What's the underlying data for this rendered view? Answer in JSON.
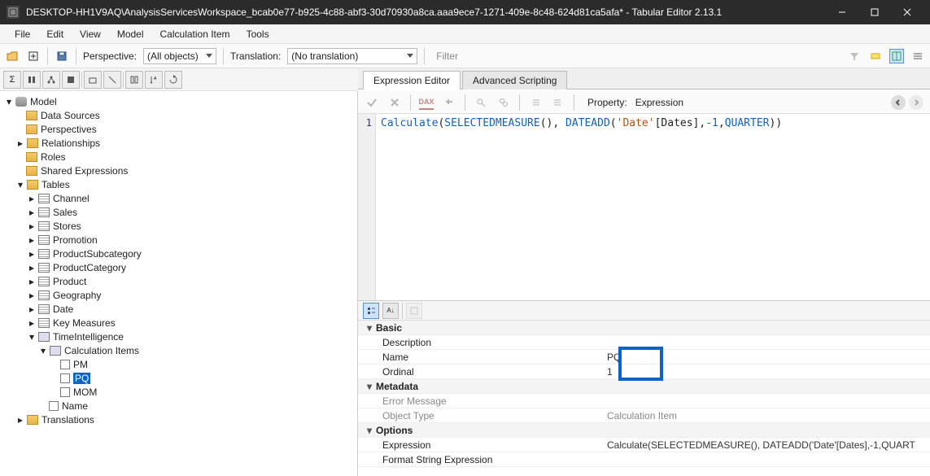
{
  "window": {
    "title": "DESKTOP-HH1V9AQ\\AnalysisServicesWorkspace_bcab0e77-b925-4c88-abf3-30d70930a8ca.aaa9ece7-1271-409e-8c48-624d81ca5afa* - Tabular Editor 2.13.1"
  },
  "menu": {
    "file": "File",
    "edit": "Edit",
    "view": "View",
    "model": "Model",
    "calc": "Calculation Item",
    "tools": "Tools"
  },
  "toolbar1": {
    "perspective_label": "Perspective:",
    "perspective_value": "(All objects)",
    "translation_label": "Translation:",
    "translation_value": "(No translation)",
    "filter_placeholder": "Filter"
  },
  "tree": {
    "model": "Model",
    "data_sources": "Data Sources",
    "perspectives": "Perspectives",
    "relationships": "Relationships",
    "roles": "Roles",
    "shared_expr": "Shared Expressions",
    "tables": "Tables",
    "t_channel": "Channel",
    "t_sales": "Sales",
    "t_stores": "Stores",
    "t_promotion": "Promotion",
    "t_psub": "ProductSubcategory",
    "t_pcat": "ProductCategory",
    "t_product": "Product",
    "t_geo": "Geography",
    "t_date": "Date",
    "t_key": "Key Measures",
    "t_ti": "TimeIntelligence",
    "calc_items": "Calculation Items",
    "ci_pm": "PM",
    "ci_pq": "PQ",
    "ci_mom": "MOM",
    "col_name": "Name",
    "translations": "Translations"
  },
  "tabs": {
    "expr": "Expression Editor",
    "adv": "Advanced Scripting"
  },
  "exprbar": {
    "property_label": "Property:",
    "property_value": "Expression"
  },
  "code": {
    "line1_a": "Calculate",
    "line1_b": "SELECTEDMEASURE",
    "line1_c": "DATEADD",
    "line1_d": "'Date'",
    "line1_e": "[Dates]",
    "line1_f": "-1",
    "line1_g": "QUARTER"
  },
  "propgrid": {
    "cat_basic": "Basic",
    "p_desc": "Description",
    "p_name": "Name",
    "p_name_v": "PQ",
    "p_ordinal": "Ordinal",
    "p_ordinal_v": "1",
    "cat_meta": "Metadata",
    "p_err": "Error Message",
    "p_objtype": "Object Type",
    "p_objtype_v": "Calculation Item",
    "cat_opt": "Options",
    "p_expr": "Expression",
    "p_expr_v": "Calculate(SELECTEDMEASURE(), DATEADD('Date'[Dates],-1,QUART",
    "p_fse": "Format String Expression"
  }
}
